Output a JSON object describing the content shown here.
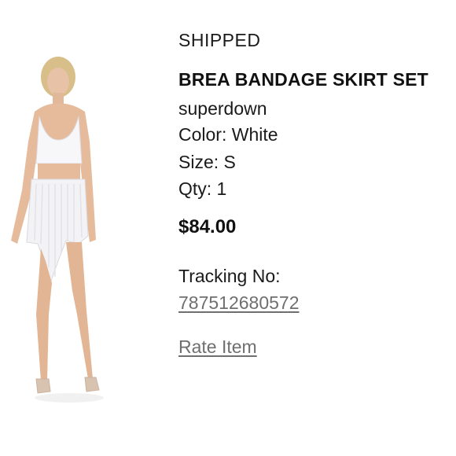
{
  "order_item": {
    "status": "SHIPPED",
    "product_name": "BREA BANDAGE SKIRT SET",
    "brand": "superdown",
    "color_line": "Color: White",
    "size_line": "Size: S",
    "qty_line": "Qty: 1",
    "price": "$84.00",
    "tracking_label": "Tracking No:",
    "tracking_number": "787512680572",
    "rate_item_label": "Rate Item"
  },
  "colors": {
    "text": "#111111",
    "link": "#6f6f6f",
    "background": "#ffffff"
  },
  "icons": {
    "product_image": "product-photo"
  }
}
